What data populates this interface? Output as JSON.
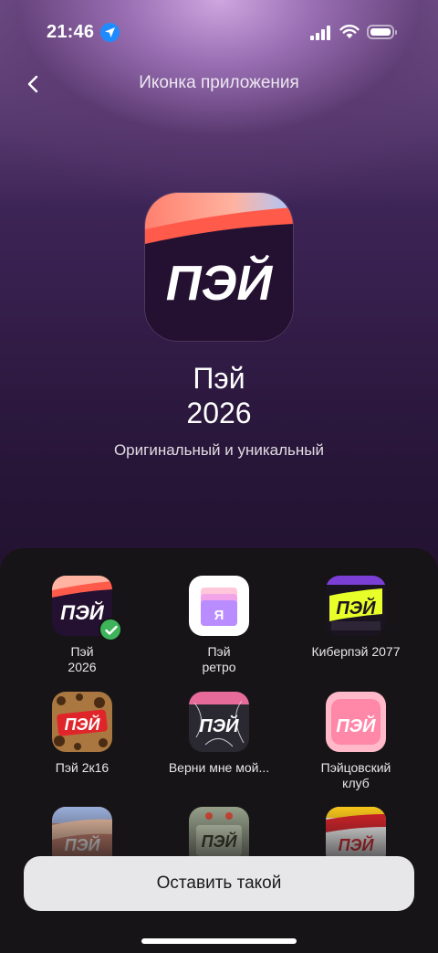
{
  "status_bar": {
    "time": "21:46"
  },
  "header": {
    "title": "Иконка приложения"
  },
  "hero": {
    "logo_text": "ПЭЙ",
    "name_line1": "Пэй",
    "name_line2": "2026",
    "subtitle": "Оригинальный и уникальный"
  },
  "icons": [
    {
      "label_line1": "Пэй",
      "label_line2": "2026",
      "selected": true,
      "glyph": "ПЭЙ"
    },
    {
      "label_line1": "Пэй",
      "label_line2": "ретро",
      "selected": false,
      "glyph": "Я"
    },
    {
      "label_line1": "Киберпэй 2077",
      "label_line2": "",
      "selected": false,
      "glyph": "ПЭЙ"
    },
    {
      "label_line1": "Пэй 2к16",
      "label_line2": "",
      "selected": false,
      "glyph": "ПЭЙ"
    },
    {
      "label_line1": "Верни мне мой...",
      "label_line2": "",
      "selected": false,
      "glyph": "ПЭЙ"
    },
    {
      "label_line1": "Пэйцовский",
      "label_line2": "клуб",
      "selected": false,
      "glyph": "ПЭЙ"
    },
    {
      "label_line1": "",
      "label_line2": "",
      "selected": false,
      "glyph": "ПЭЙ"
    },
    {
      "label_line1": "",
      "label_line2": "",
      "selected": false,
      "glyph": "ПЭЙ"
    },
    {
      "label_line1": "",
      "label_line2": "",
      "selected": false,
      "glyph": "ПЭЙ"
    }
  ],
  "button": {
    "label": "Оставить такой"
  },
  "colors": {
    "accent_coral": "#ff5a4a",
    "dark_purple": "#1f0f2c",
    "check_green": "#3db35a"
  }
}
